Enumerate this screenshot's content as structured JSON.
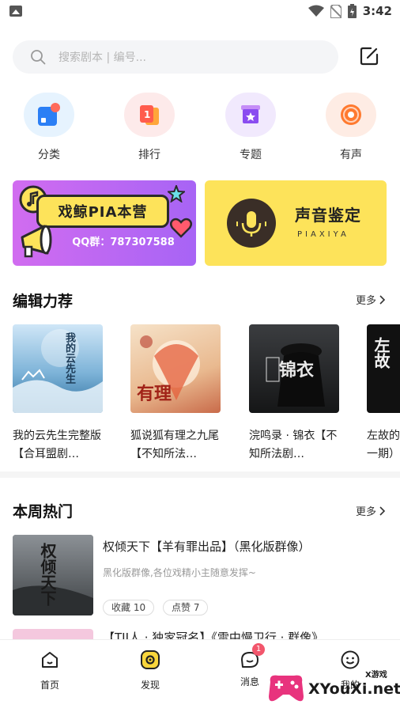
{
  "status_bar": {
    "time": "3:42"
  },
  "search": {
    "placeholder": "搜索剧本 | 编号..."
  },
  "categories": [
    {
      "label": "分类",
      "icon": "category-icon"
    },
    {
      "label": "排行",
      "icon": "rank-icon"
    },
    {
      "label": "专题",
      "icon": "topic-icon"
    },
    {
      "label": "有声",
      "icon": "audio-icon"
    }
  ],
  "banners": {
    "left": {
      "title": "戏鲸PIA本营",
      "qq": "QQ群：787307588"
    },
    "right": {
      "title": "声音鉴定",
      "subtitle": "PIAXIYA"
    }
  },
  "editor_picks": {
    "title": "编辑力荐",
    "more": "更多",
    "items": [
      {
        "title": "我的云先生完整版【合耳盟剧…",
        "cover_text": "我的云先生"
      },
      {
        "title": "狐说狐有理之九尾【不知所法…",
        "cover_text": "有理"
      },
      {
        "title": "浣鸣录 · 锦衣【不知所法剧…",
        "cover_text": "锦衣"
      },
      {
        "title": "左故的一期）",
        "cover_text": "左故"
      }
    ]
  },
  "weekly_hot": {
    "title": "本周热门",
    "more": "更多",
    "items": [
      {
        "title": "权倾天下【羊有罪出品】（黑化版群像）",
        "desc": "黑化版群像,各位戏精小主随意发挥~",
        "collect": "收藏 10",
        "likes": "点赞 7",
        "cover_text": "权倾天下"
      },
      {
        "title": "【TJI人 · 独家冠名】《雷中慢卫行 · 群像》"
      }
    ]
  },
  "bottom_nav": [
    {
      "label": "首页"
    },
    {
      "label": "发现"
    },
    {
      "label": "消息",
      "badge": "1"
    },
    {
      "label": "我的"
    }
  ],
  "watermark": {
    "text": "XYouXi.net",
    "small": "X游戏"
  },
  "colors": {
    "accent_yellow": "#fde35a",
    "purple": "#b266f3",
    "badge_red": "#f2566c"
  }
}
